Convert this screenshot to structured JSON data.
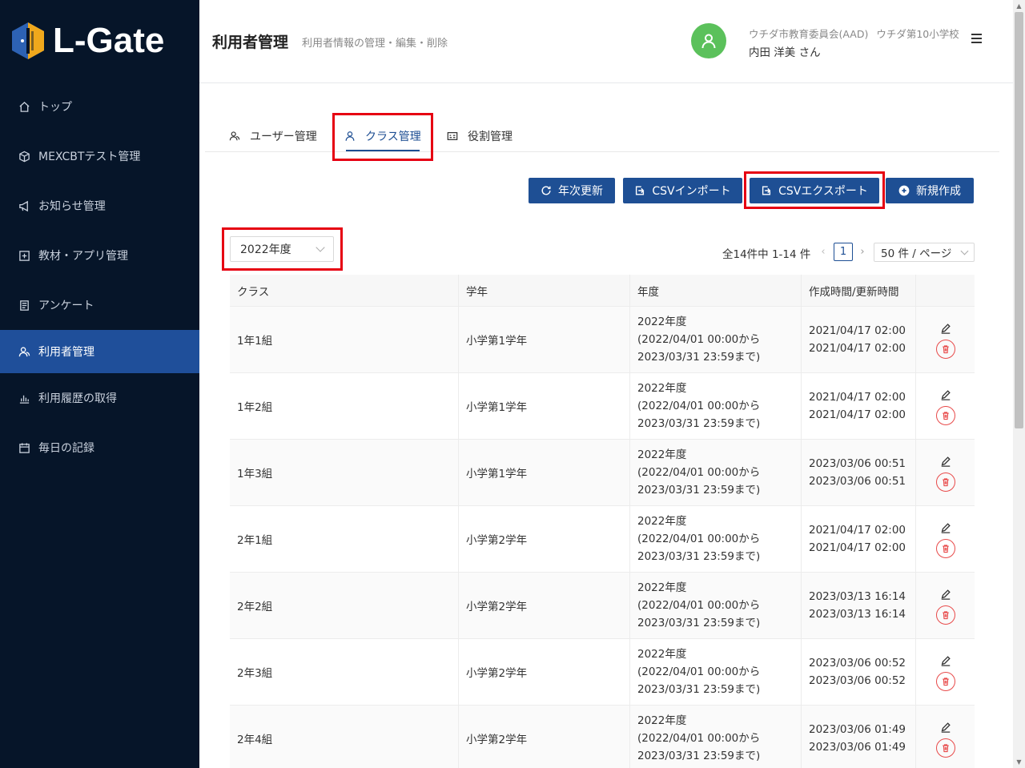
{
  "app": {
    "name": "L-Gate",
    "brand_color": "#061529",
    "accent_color": "#1e4f94",
    "highlight_color": "#e60012"
  },
  "sidebar": {
    "items": [
      {
        "label": "トップ",
        "icon": "home-icon"
      },
      {
        "label": "MEXCBTテスト管理",
        "icon": "cube-icon"
      },
      {
        "label": "お知らせ管理",
        "icon": "megaphone-icon"
      },
      {
        "label": "教材・アプリ管理",
        "icon": "plus-square-icon"
      },
      {
        "label": "アンケート",
        "icon": "survey-icon"
      },
      {
        "label": "利用者管理",
        "icon": "users-icon",
        "active": true
      },
      {
        "label": "利用履歴の取得",
        "icon": "bar-chart-icon"
      },
      {
        "label": "毎日の記録",
        "icon": "calendar-icon"
      }
    ]
  },
  "header": {
    "title": "利用者管理",
    "subtitle": "利用者情報の管理・編集・削除",
    "org": "ウチダ市教育委員会(AAD)",
    "school": "ウチダ第10小学校",
    "user": "内田 洋美 さん"
  },
  "tabs": [
    {
      "label": "ユーザー管理",
      "icon": "users-icon"
    },
    {
      "label": "クラス管理",
      "icon": "user-icon",
      "active": true
    },
    {
      "label": "役割管理",
      "icon": "id-card-icon"
    }
  ],
  "actions": {
    "annual_update": "年次更新",
    "csv_import": "CSVインポート",
    "csv_export": "CSVエクスポート",
    "create_new": "新規作成"
  },
  "filter": {
    "year_selected": "2022年度"
  },
  "pagination": {
    "total_text": "全14件中 1-14 件",
    "current_page": "1",
    "page_size": "50 件 / ページ"
  },
  "table": {
    "headers": [
      "クラス",
      "学年",
      "年度",
      "作成時間/更新時間",
      ""
    ],
    "rows": [
      {
        "class": "1年1組",
        "grade": "小学第1学年",
        "year": "2022年度",
        "period_start": "(2022/04/01 00:00から",
        "period_end": "2023/03/31 23:59まで)",
        "created": "2021/04/17 02:00",
        "updated": "2021/04/17 02:00"
      },
      {
        "class": "1年2組",
        "grade": "小学第1学年",
        "year": "2022年度",
        "period_start": "(2022/04/01 00:00から",
        "period_end": "2023/03/31 23:59まで)",
        "created": "2021/04/17 02:00",
        "updated": "2021/04/17 02:00"
      },
      {
        "class": "1年3組",
        "grade": "小学第1学年",
        "year": "2022年度",
        "period_start": "(2022/04/01 00:00から",
        "period_end": "2023/03/31 23:59まで)",
        "created": "2023/03/06 00:51",
        "updated": "2023/03/06 00:51"
      },
      {
        "class": "2年1組",
        "grade": "小学第2学年",
        "year": "2022年度",
        "period_start": "(2022/04/01 00:00から",
        "period_end": "2023/03/31 23:59まで)",
        "created": "2021/04/17 02:00",
        "updated": "2021/04/17 02:00"
      },
      {
        "class": "2年2組",
        "grade": "小学第2学年",
        "year": "2022年度",
        "period_start": "(2022/04/01 00:00から",
        "period_end": "2023/03/31 23:59まで)",
        "created": "2023/03/13 16:14",
        "updated": "2023/03/13 16:14"
      },
      {
        "class": "2年3組",
        "grade": "小学第2学年",
        "year": "2022年度",
        "period_start": "(2022/04/01 00:00から",
        "period_end": "2023/03/31 23:59まで)",
        "created": "2023/03/06 00:52",
        "updated": "2023/03/06 00:52"
      },
      {
        "class": "2年4組",
        "grade": "小学第2学年",
        "year": "2022年度",
        "period_start": "(2022/04/01 00:00から",
        "period_end": "2023/03/31 23:59まで)",
        "created": "2023/03/06 01:49",
        "updated": "2023/03/06 01:49"
      }
    ]
  }
}
